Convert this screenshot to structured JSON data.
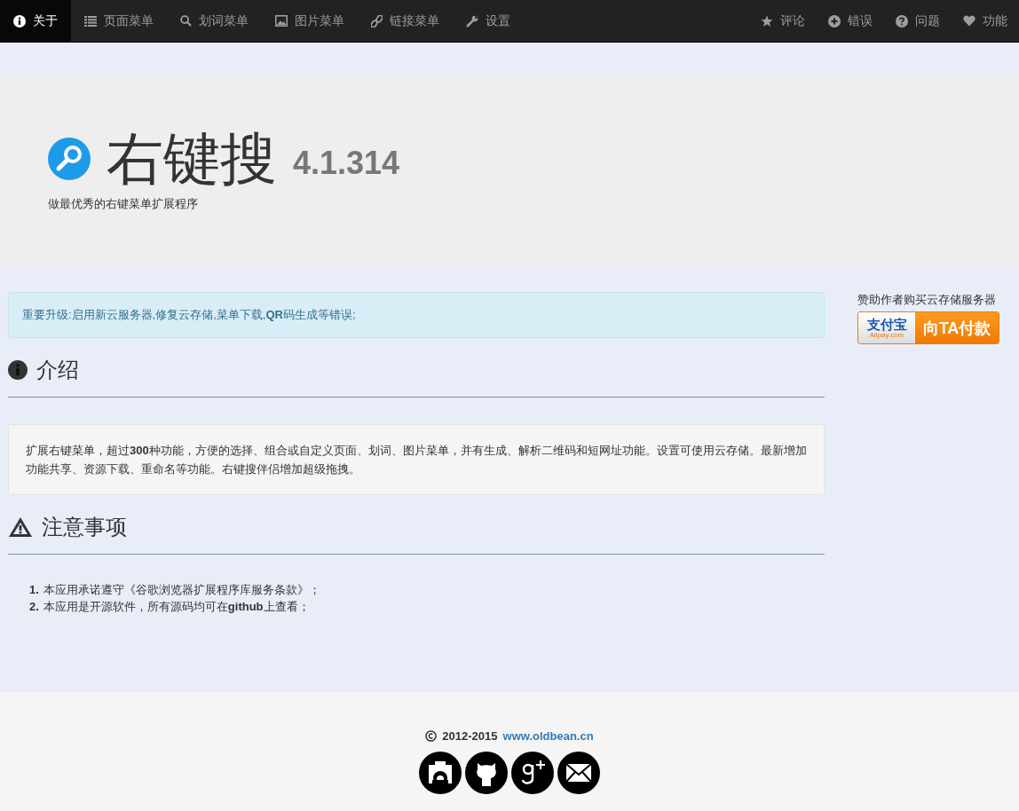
{
  "nav": {
    "left": [
      {
        "label": "关于",
        "kind": "info",
        "selected": true
      },
      {
        "label": "页面菜单",
        "kind": "list",
        "selected": false
      },
      {
        "label": "划词菜单",
        "kind": "search",
        "selected": false
      },
      {
        "label": "图片菜单",
        "kind": "picture",
        "selected": false
      },
      {
        "label": "链接菜单",
        "kind": "link",
        "selected": false
      },
      {
        "label": "设置",
        "kind": "wrench",
        "selected": false
      }
    ],
    "right": [
      {
        "label": "评论",
        "kind": "star",
        "selected": false
      },
      {
        "label": "错误",
        "kind": "plus",
        "selected": false
      },
      {
        "label": "问题",
        "kind": "question",
        "selected": false
      },
      {
        "label": "功能",
        "kind": "heart",
        "selected": false
      }
    ]
  },
  "hero": {
    "title": "右键搜",
    "version": "4.1.314",
    "tagline": "做最优秀的右键菜单扩展程序"
  },
  "alert": "重要升级:启用新云服务器,修复云存储,菜单下载,**QR**码生成等错误;",
  "sections": [
    {
      "title": "介绍",
      "kind": "well",
      "text": "扩展右键菜单，超过**300**种功能，方便的选择、组合或自定义页面、划词、图片菜单，并有生成、解析二维码和短网址功能。设置可使用云存储。最新增加功能共享、资源下载、重命名等功能。右键搜伴侣增加超级拖拽。"
    },
    {
      "title": "注意事项",
      "kind": "list",
      "items": [
        {
          "number": "1.",
          "text": "本应用承诺遵守《谷歌浏览器扩展程序库服务条款》；"
        },
        {
          "number": "2.",
          "text": "本应用是开源软件，所有源码均可在**github**上查看；"
        }
      ]
    }
  ],
  "sidebar": {
    "caption": "赞助作者购买云存储服务器",
    "pay_logo": "支付宝",
    "pay_domain": "Alipay.com",
    "pay_label": "向TA付款"
  },
  "footer": {
    "years": "2012-2015",
    "link": "www.oldbean.cn"
  }
}
